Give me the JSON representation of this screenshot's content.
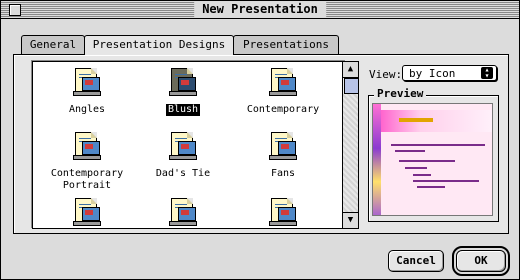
{
  "window": {
    "title": "New Presentation"
  },
  "tabs": [
    {
      "label": "General"
    },
    {
      "label": "Presentation Designs"
    },
    {
      "label": "Presentations"
    }
  ],
  "active_tab": "Presentation Designs",
  "designs": [
    {
      "label": "Angles",
      "selected": false
    },
    {
      "label": "Blush",
      "selected": true
    },
    {
      "label": "Contemporary",
      "selected": false
    },
    {
      "label": "Contemporary Portrait",
      "selected": false
    },
    {
      "label": "Dad's Tie",
      "selected": false
    },
    {
      "label": "Fans",
      "selected": false
    },
    {
      "label": "",
      "selected": false
    },
    {
      "label": "",
      "selected": false
    },
    {
      "label": "",
      "selected": false
    }
  ],
  "view": {
    "label": "View:",
    "selected_option": "by Icon"
  },
  "preview": {
    "label": "Preview"
  },
  "buttons": {
    "cancel": "Cancel",
    "ok": "OK"
  }
}
